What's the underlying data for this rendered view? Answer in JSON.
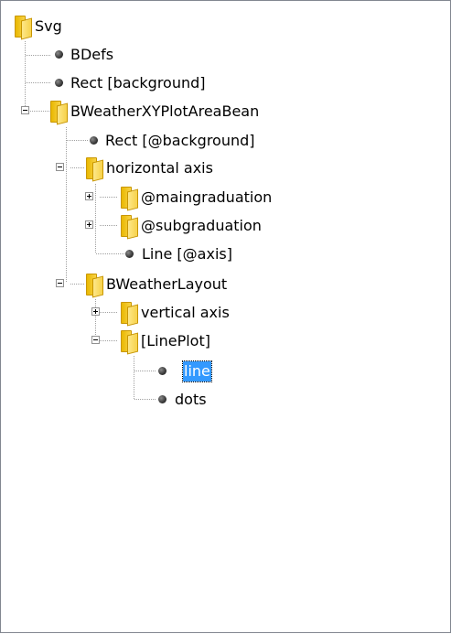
{
  "tree": {
    "nodes": [
      {
        "label": "Svg",
        "icon": "folder-icon",
        "expander": "none",
        "selected": false
      },
      {
        "label": "BDefs",
        "icon": "leaf-node-icon",
        "expander": "none",
        "selected": false
      },
      {
        "label": "Rect [background]",
        "icon": "leaf-node-icon",
        "expander": "none",
        "selected": false
      },
      {
        "label": "BWeatherXYPlotAreaBean",
        "icon": "folder-icon",
        "expander": "expanded",
        "selected": false
      },
      {
        "label": "Rect [@background]",
        "icon": "leaf-node-icon",
        "expander": "none",
        "selected": false
      },
      {
        "label": "horizontal axis",
        "icon": "folder-icon",
        "expander": "expanded",
        "selected": false
      },
      {
        "label": "@maingraduation",
        "icon": "folder-icon",
        "expander": "collapsed",
        "selected": false
      },
      {
        "label": "@subgraduation",
        "icon": "folder-icon",
        "expander": "collapsed",
        "selected": false
      },
      {
        "label": "Line [@axis]",
        "icon": "leaf-node-icon",
        "expander": "none",
        "selected": false
      },
      {
        "label": "BWeatherLayout",
        "icon": "folder-icon",
        "expander": "expanded",
        "selected": false
      },
      {
        "label": "vertical axis",
        "icon": "folder-icon",
        "expander": "collapsed",
        "selected": false
      },
      {
        "label": "[LinePlot]",
        "icon": "folder-icon",
        "expander": "expanded",
        "selected": false
      },
      {
        "label": "line",
        "icon": "leaf-node-icon",
        "expander": "none",
        "selected": true
      },
      {
        "label": "dots",
        "icon": "leaf-node-icon",
        "expander": "none",
        "selected": false
      }
    ],
    "colors": {
      "selection_background": "#3399ff",
      "selection_text": "#ffffff",
      "connector_lines": "#a0a0a0",
      "panel_border": "#828790",
      "folder": "#f2c21a"
    }
  }
}
